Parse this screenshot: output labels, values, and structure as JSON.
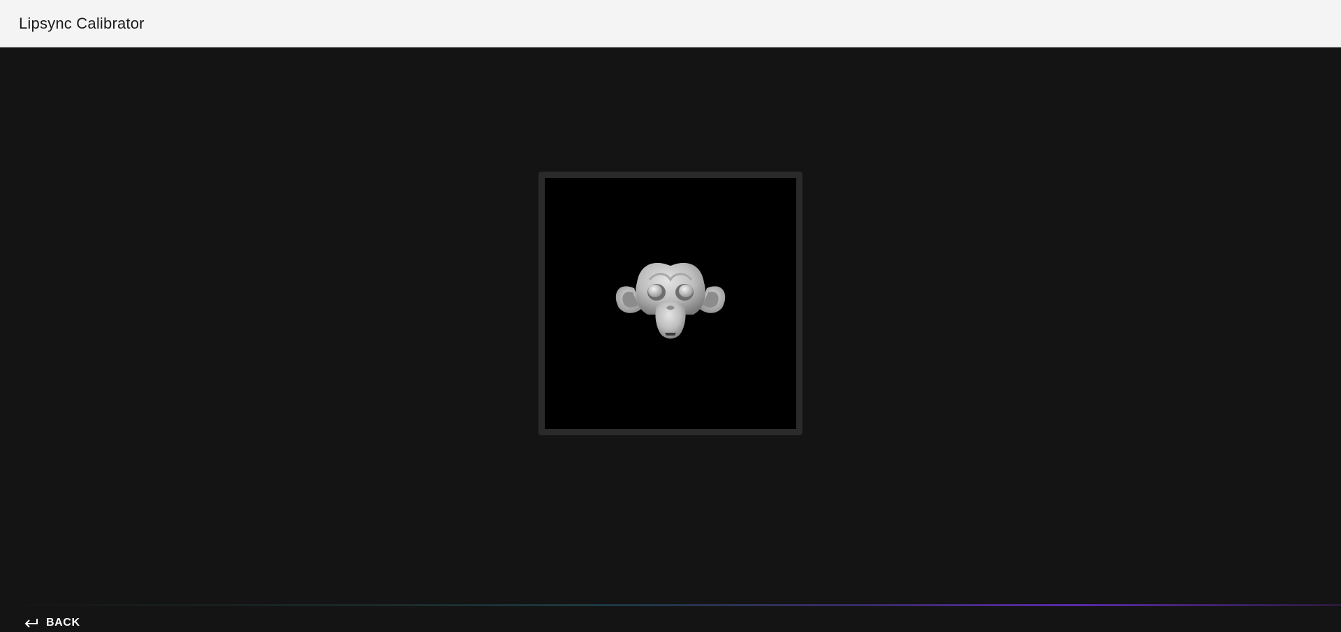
{
  "app_bar": {
    "title": "Lipsync Calibrator"
  },
  "viewport": {
    "subject": "monkey-head-3d-model"
  },
  "back_button": {
    "label": "BACK",
    "icon": "return-arrow-icon"
  },
  "colors": {
    "app_bar_bg": "#f4f4f4",
    "background": "#141414",
    "viewport_bg": "#000000",
    "frame": "#2a2a2a"
  }
}
